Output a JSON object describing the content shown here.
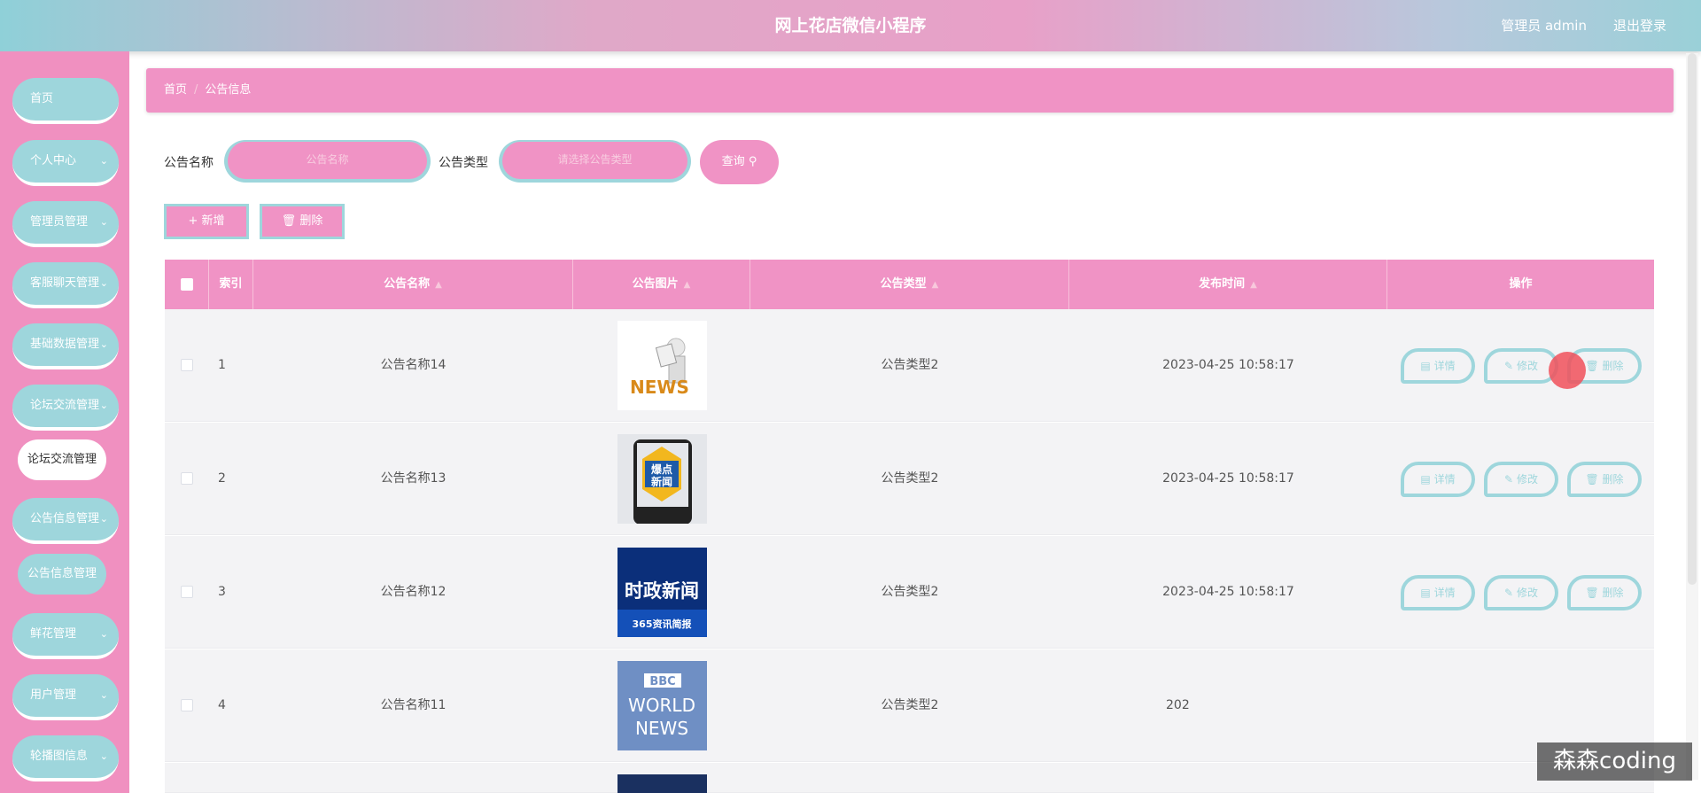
{
  "header": {
    "title": "网上花店微信小程序",
    "user": "管理员 admin",
    "logout": "退出登录"
  },
  "sidebar": {
    "items": [
      {
        "label": "首页",
        "has_arrow": false
      },
      {
        "label": "个人中心",
        "has_arrow": true
      },
      {
        "label": "管理员管理",
        "has_arrow": true
      },
      {
        "label": "客服聊天管理",
        "has_arrow": true
      },
      {
        "label": "基础数据管理",
        "has_arrow": true
      },
      {
        "label": "论坛交流管理",
        "has_arrow": true
      },
      {
        "label": "公告信息管理",
        "has_arrow": true
      },
      {
        "label": "鲜花管理",
        "has_arrow": true
      },
      {
        "label": "用户管理",
        "has_arrow": true
      },
      {
        "label": "轮播图信息",
        "has_arrow": true
      }
    ],
    "sub_forum": "论坛交流管理",
    "sub_notice": "公告信息管理"
  },
  "breadcrumb": {
    "home": "首页",
    "current": "公告信息"
  },
  "search": {
    "name_label": "公告名称",
    "name_placeholder": "公告名称",
    "type_label": "公告类型",
    "type_placeholder": "请选择公告类型",
    "button": "查询"
  },
  "actions": {
    "add": "新增",
    "delete": "删除"
  },
  "table": {
    "columns": [
      "索引",
      "公告名称",
      "公告图片",
      "公告类型",
      "发布时间",
      "操作"
    ],
    "rows": [
      {
        "index": "1",
        "name": "公告名称14",
        "type": "公告类型2",
        "time": "2023-04-25 10:58:17",
        "image": "news-3d-figure"
      },
      {
        "index": "2",
        "name": "公告名称13",
        "type": "公告类型2",
        "time": "2023-04-25 10:58:17",
        "image": "baodian-xinwen"
      },
      {
        "index": "3",
        "name": "公告名称12",
        "type": "公告类型2",
        "time": "2023-04-25 10:58:17",
        "image": "shizheng-xinwen"
      },
      {
        "index": "4",
        "name": "公告名称11",
        "type": "公告类型2",
        "time": "202",
        "image": "bbc-world-news"
      }
    ],
    "op_detail": "详情",
    "op_edit": "修改",
    "op_delete": "删除"
  },
  "thumb_text": {
    "news": "NEWS",
    "baodian_1": "爆点",
    "baodian_2": "新闻",
    "shizheng": "时政新闻",
    "shizheng_sub": "365资讯简报",
    "bbc": "BBC",
    "world": "WORLD",
    "bbc_news": "NEWS"
  },
  "watermark": "森森coding",
  "colors": {
    "pink": "#f093c5",
    "teal": "#9ed6dc"
  }
}
